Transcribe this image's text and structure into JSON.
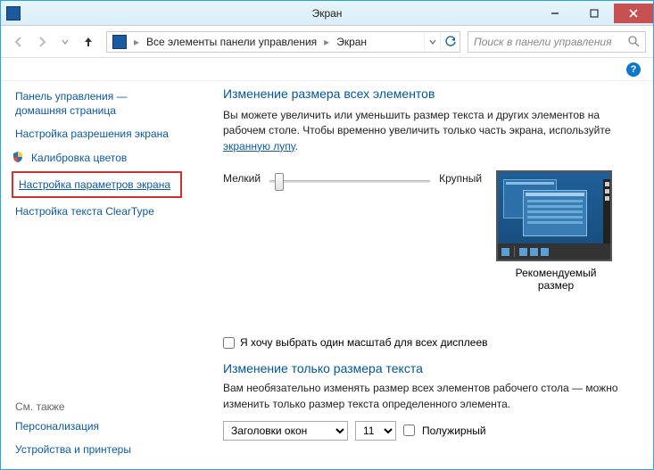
{
  "window": {
    "title": "Экран"
  },
  "breadcrumb": {
    "item1": "Все элементы панели управления",
    "item2": "Экран"
  },
  "search": {
    "placeholder": "Поиск в панели управления"
  },
  "sidebar": {
    "items": [
      "Панель управления — домашняя страница",
      "Настройка разрешения экрана",
      "Калибровка цветов",
      "Настройка параметров экрана",
      "Настройка текста ClearType"
    ],
    "seealso_header": "См. также",
    "seealso": [
      "Персонализация",
      "Устройства и принтеры"
    ]
  },
  "main": {
    "h1": "Изменение размера всех элементов",
    "desc_pre": "Вы можете увеличить или уменьшить размер текста и других элементов на рабочем столе. Чтобы временно увеличить только часть экрана, используйте ",
    "desc_link": "экранную лупу",
    "desc_post": ".",
    "slider": {
      "min": "Мелкий",
      "max": "Крупный"
    },
    "preview_caption": "Рекомендуемый размер",
    "checkbox_all": "Я хочу выбрать один масштаб для всех дисплеев",
    "h2": "Изменение только размера текста",
    "desc2": "Вам необязательно изменять размер всех элементов рабочего стола — можно изменить только размер текста определенного элемента.",
    "select_element": "Заголовки окон",
    "select_size": "11",
    "bold_label": "Полужирный"
  }
}
